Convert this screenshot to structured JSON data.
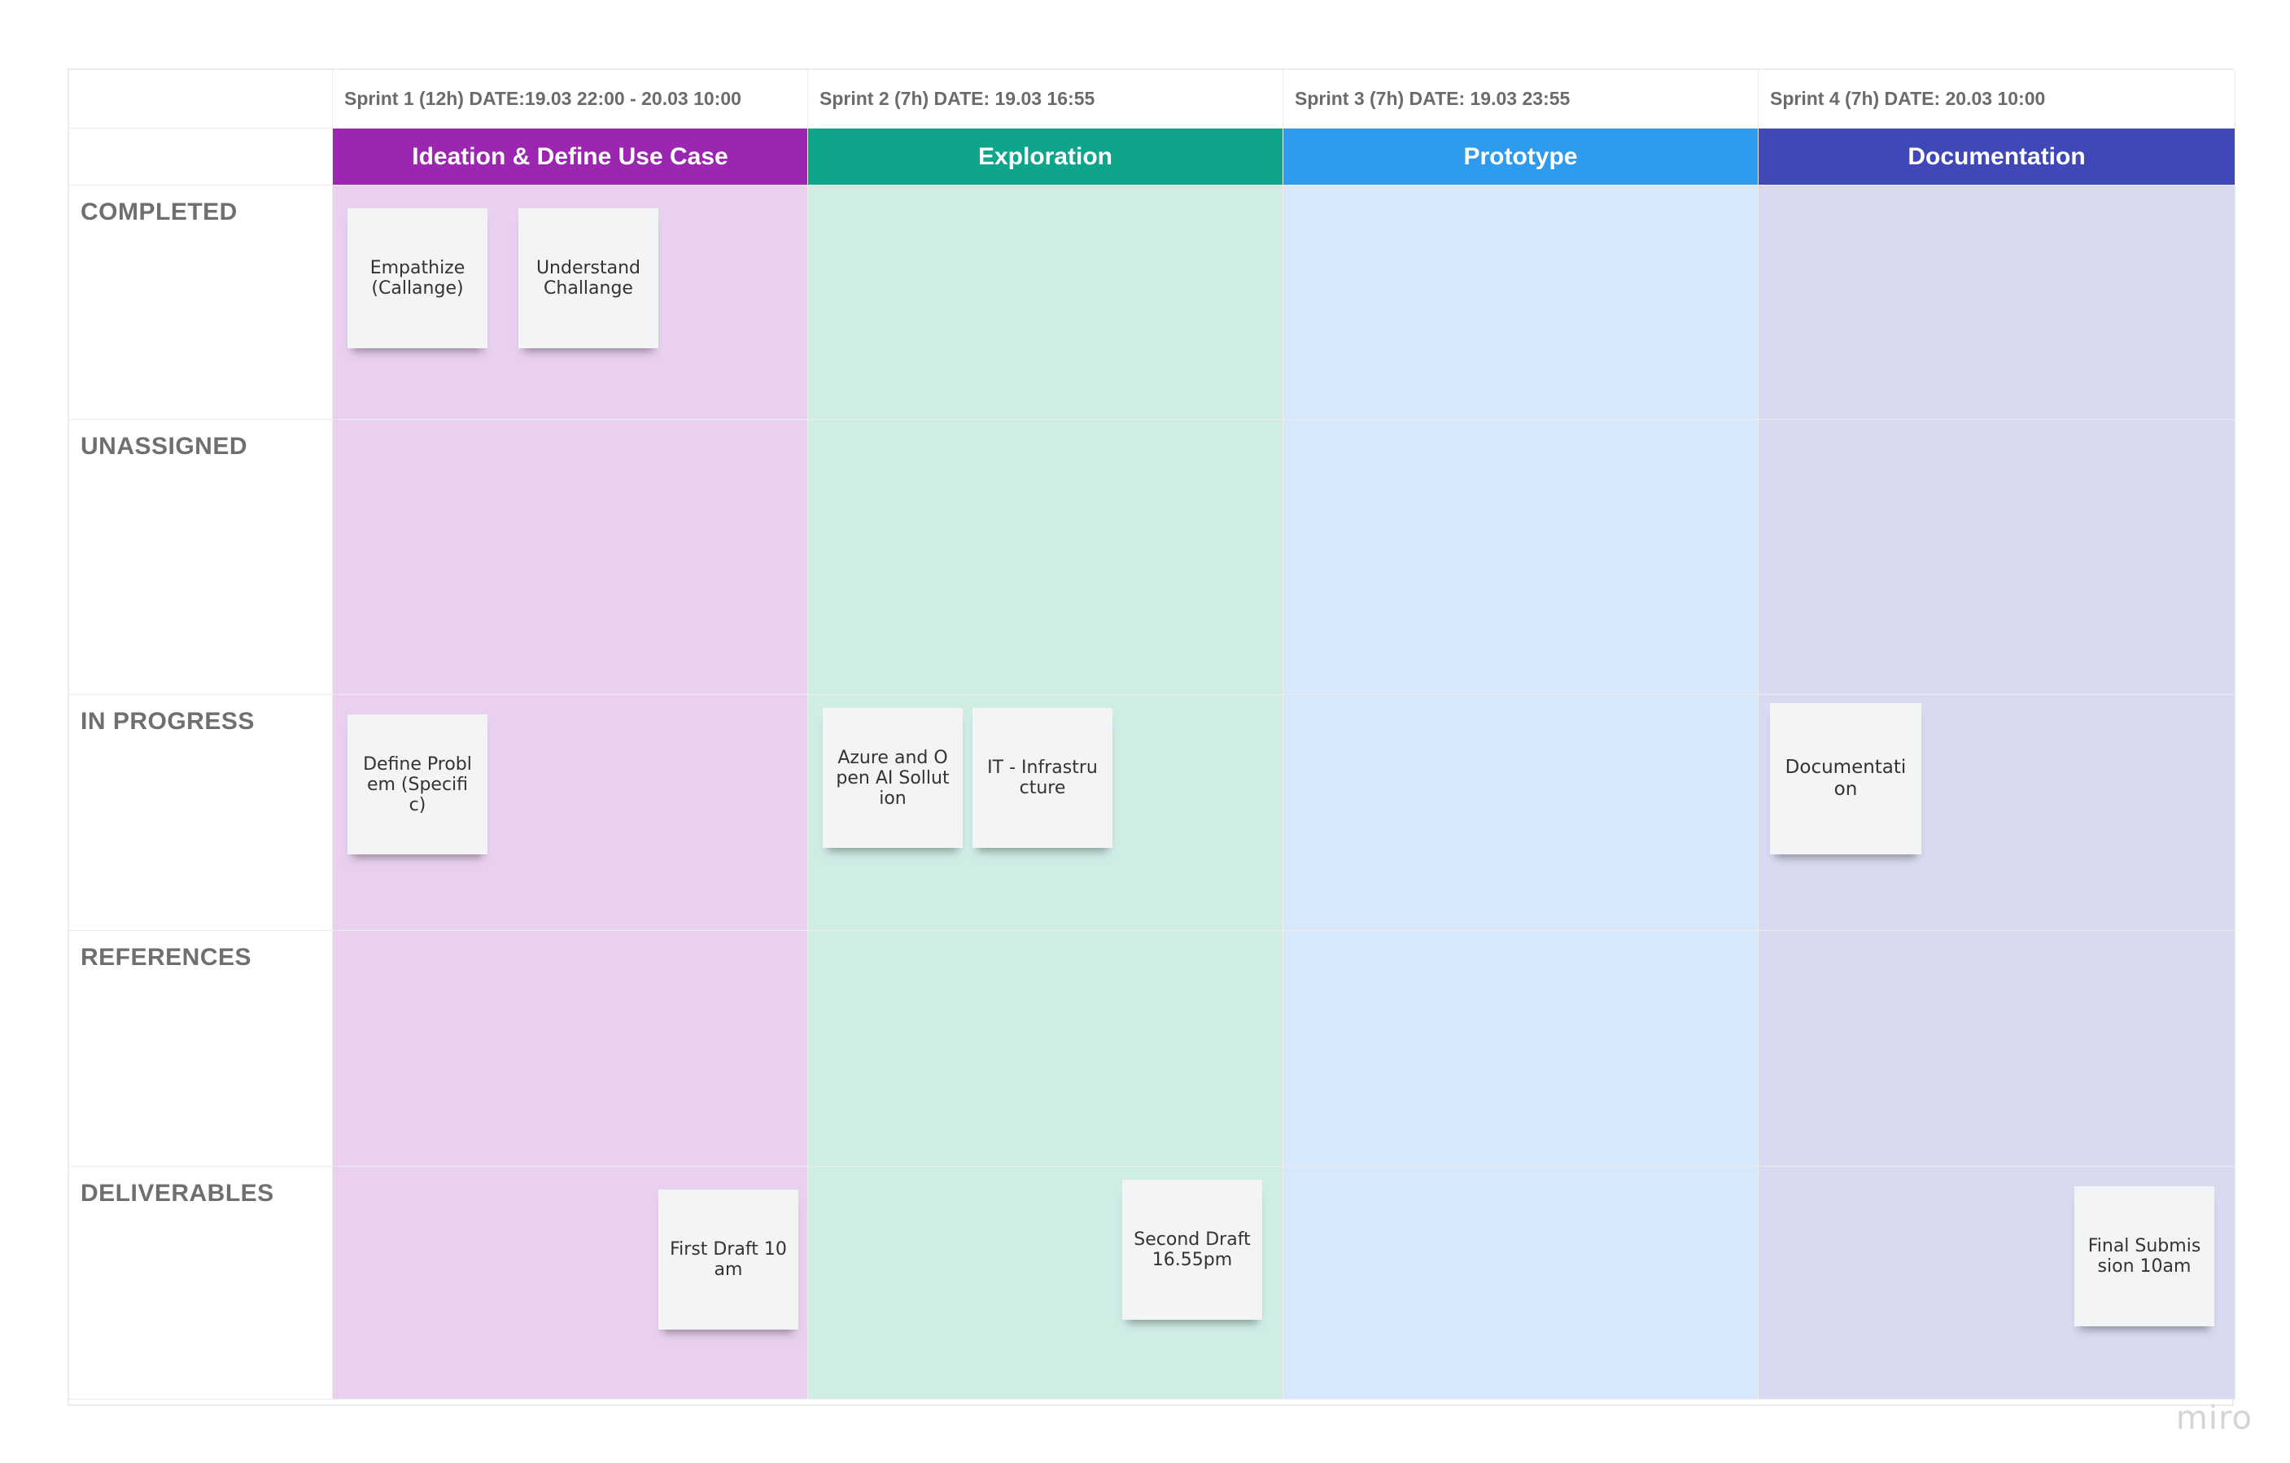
{
  "board": {
    "sprints": [
      "Sprint 1 (12h) DATE:19.03 22:00 - 20.03 10:00",
      "Sprint 2 (7h) DATE: 19.03 16:55",
      "Sprint 3 (7h) DATE: 19.03 23:55",
      "Sprint 4 (7h) DATE: 20.03 10:00"
    ],
    "phases": [
      {
        "label": "Ideation & Define Use Case",
        "color": "#9b27b0"
      },
      {
        "label": "Exploration",
        "color": "#0ea58a"
      },
      {
        "label": "Prototype",
        "color": "#2f9bef"
      },
      {
        "label": "Documentation",
        "color": "#3f48b6"
      }
    ],
    "lane_colors": [
      "#e8d0ee",
      "#cfece5",
      "#d6e8f9",
      "#d9daf0"
    ],
    "rows": [
      "COMPLETED",
      "UNASSIGNED",
      "IN PROGRESS",
      "REFERENCES",
      "DELIVERABLES"
    ]
  },
  "stickies": {
    "empathize": "Empathize (Callange)",
    "understand": "Understand Challange",
    "define_problem": "Define Problem (Specific)",
    "azure": "Azure and Open AI Sollution",
    "it_infra": "IT - Infrastructure",
    "documentation": "Documentation",
    "first_draft": "First Draft 10am",
    "second_draft": "Second Draft 16.55pm",
    "final_submission": "Final Submission 10am"
  },
  "logo": "miro"
}
